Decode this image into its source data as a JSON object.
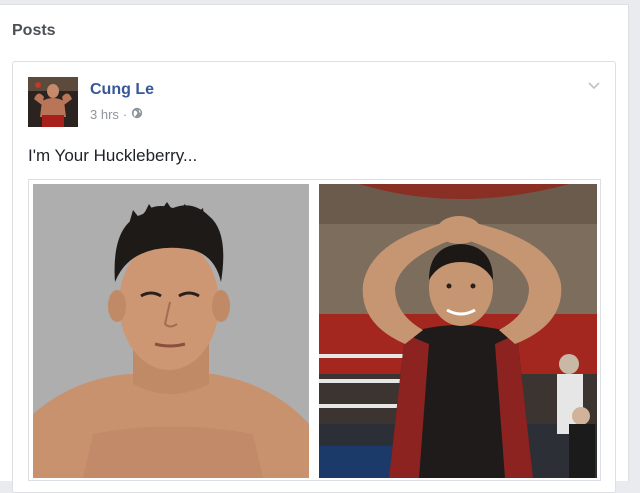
{
  "section": {
    "title": "Posts"
  },
  "post": {
    "author": "Cung Le",
    "time": "3 hrs",
    "separator": "·",
    "audience_icon": "globe-icon",
    "menu_icon": "chevron-down-icon",
    "text": "I'm Your Huckleberry...",
    "photos": [
      {
        "subject": "portrait-photo"
      },
      {
        "subject": "ring-photo"
      }
    ]
  },
  "colors": {
    "name_link": "#365899",
    "meta": "#90949c",
    "background": "#e9ebee"
  }
}
